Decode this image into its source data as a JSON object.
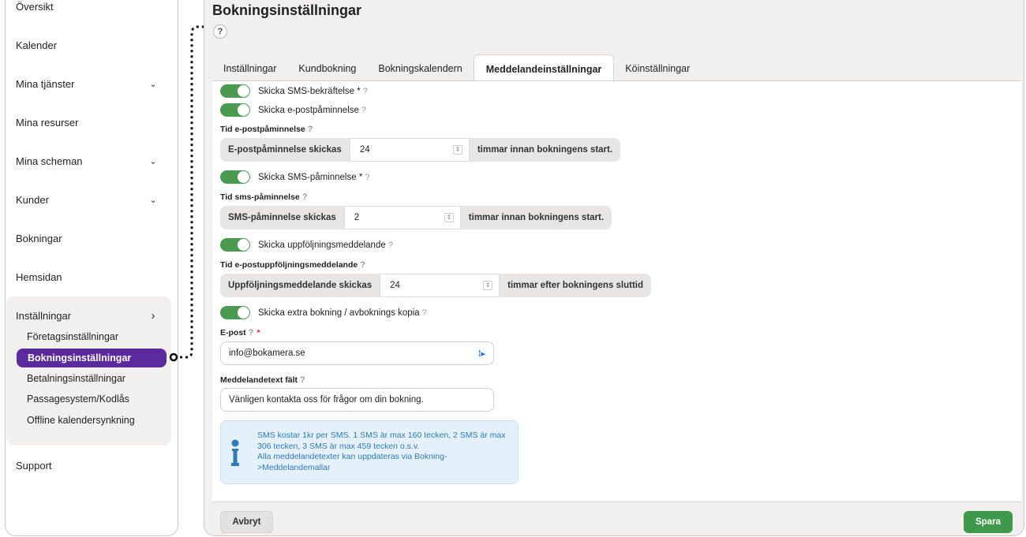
{
  "sidebar": {
    "items": [
      {
        "label": "Översikt",
        "has_chevron": false
      },
      {
        "label": "Kalender",
        "has_chevron": false
      },
      {
        "label": "Mina tjänster",
        "has_chevron": true,
        "chevron": "⌄"
      },
      {
        "label": "Mina resurser",
        "has_chevron": false
      },
      {
        "label": "Mina scheman",
        "has_chevron": true,
        "chevron": "⌄"
      },
      {
        "label": "Kunder",
        "has_chevron": true,
        "chevron": "⌄"
      },
      {
        "label": "Bokningar",
        "has_chevron": false
      },
      {
        "label": "Hemsidan",
        "has_chevron": false
      }
    ],
    "settings": {
      "label": "Inställningar",
      "chevron": "›",
      "sub_items": [
        "Företagsinställningar",
        "Bokningsinställningar",
        "Betalningsinställningar",
        "Passagesystem/Kodlås",
        "Offline kalendersynkning"
      ],
      "active_index": 1
    },
    "support": "Support"
  },
  "main": {
    "title": "Bokningsinställningar",
    "help_icon": "?",
    "tabs": [
      "Inställningar",
      "Kundbokning",
      "Bokningskalendern",
      "Meddelandeinställningar",
      "Köinställningar"
    ],
    "active_tab": 3
  },
  "form": {
    "sms_confirm": {
      "label": "Skicka SMS-bekräftelse *",
      "enabled": true
    },
    "email_reminder": {
      "label": "Skicka e-postpåminnelse",
      "enabled": true
    },
    "email_reminder_time": {
      "label": "Tid e-postpåminnelse",
      "prefix": "E-postpåminnelse skickas",
      "value": "24",
      "suffix": "timmar innan bokningens start."
    },
    "sms_reminder": {
      "label": "Skicka SMS-påminnelse *",
      "enabled": true
    },
    "sms_reminder_time": {
      "label": "Tid sms-påminnelse",
      "prefix": "SMS-påminnelse skickas",
      "value": "2",
      "suffix": "timmar innan bokningens start."
    },
    "followup": {
      "label": "Skicka uppföljningsmeddelande",
      "enabled": true
    },
    "followup_time": {
      "label": "Tid e-postuppföljningsmeddelande",
      "prefix": "Uppföljningsmeddelande skickas",
      "value": "24",
      "suffix": "timmar efter bokningens sluttid"
    },
    "extra_copy": {
      "label": "Skicka extra bokning / avboknings kopia",
      "enabled": true
    },
    "email": {
      "label": "E-post",
      "required_mark": "*",
      "value": "info@bokamera.se"
    },
    "message_text": {
      "label": "Meddelandetext fält",
      "value": "Vänligen kontakta oss för frågor om din bokning."
    },
    "info": {
      "line1": "SMS kostar 1kr per SMS. 1 SMS är max 160 tecken, 2 SMS är max 306 tecken, 3 SMS är max 459 tecken o.s.v.",
      "line2": "Alla meddelandetexter kan uppdateras via Bokning->Meddelandemallar"
    },
    "question_mark": "?"
  },
  "footer": {
    "cancel_label": "Avbryt",
    "save_label": "Spara"
  },
  "colors": {
    "accent": "#5b2a9c",
    "toggle_on": "#4a9a4f",
    "save": "#3e9a4a",
    "info_text": "#2f7ab8"
  }
}
